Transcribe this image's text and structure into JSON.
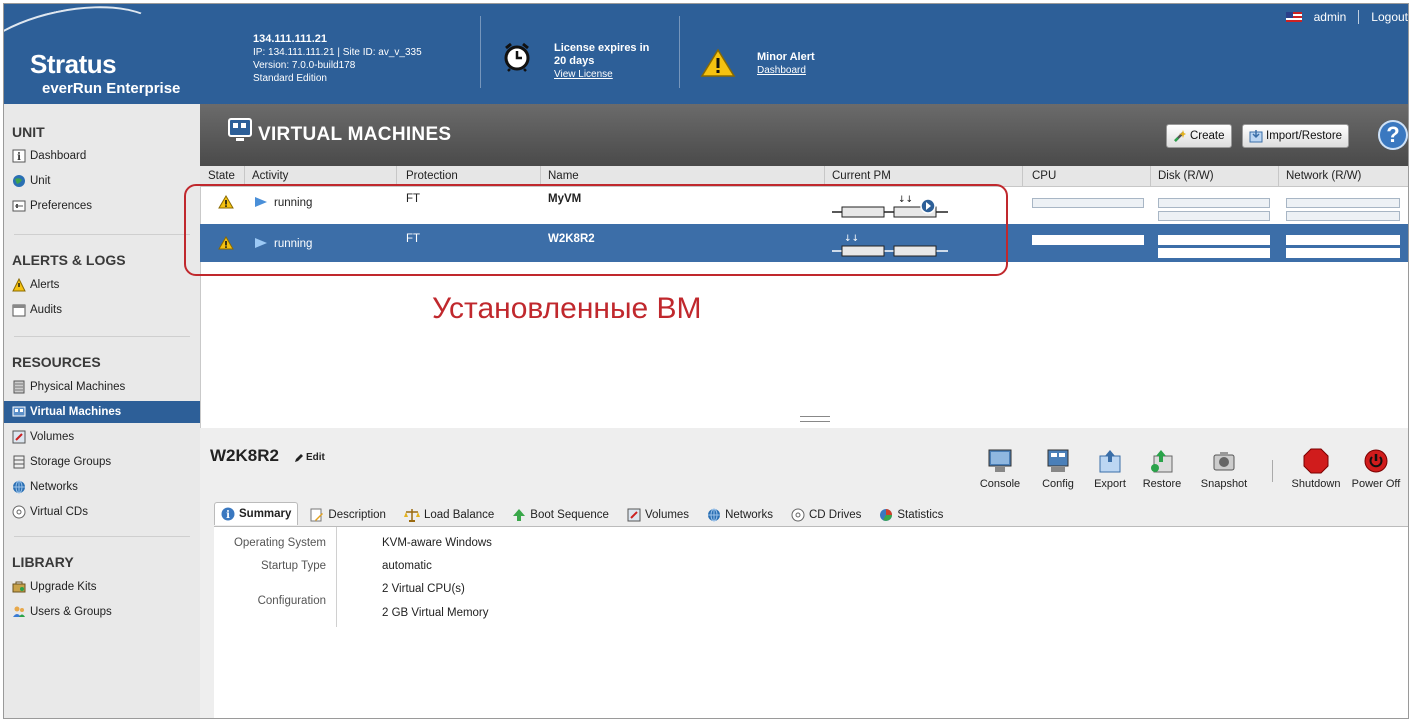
{
  "header": {
    "brand": "Stratus",
    "product": "everRun Enterprise",
    "system": {
      "ip_title": "134.111.111.21",
      "ip_site": "IP: 134.111.111.21  |  Site ID: av_v_335",
      "version": "Version: 7.0.0-build178",
      "edition": "Standard Edition"
    },
    "license": {
      "line1": "License expires in",
      "line2": "20 days",
      "link": "View License"
    },
    "alert": {
      "title": "Minor Alert",
      "link": "Dashboard"
    },
    "user": "admin",
    "logout": "Logout"
  },
  "sidebar": {
    "unit": {
      "heading": "UNIT",
      "items": [
        {
          "label": "Dashboard",
          "icon": "info-icon"
        },
        {
          "label": "Unit",
          "icon": "globe-icon"
        },
        {
          "label": "Preferences",
          "icon": "preferences-icon"
        }
      ]
    },
    "alerts": {
      "heading": "ALERTS & LOGS",
      "items": [
        {
          "label": "Alerts",
          "icon": "warning-icon"
        },
        {
          "label": "Audits",
          "icon": "calendar-icon"
        }
      ]
    },
    "resources": {
      "heading": "RESOURCES",
      "items": [
        {
          "label": "Physical Machines",
          "icon": "server-icon"
        },
        {
          "label": "Virtual Machines",
          "icon": "vm-icon",
          "active": true
        },
        {
          "label": "Volumes",
          "icon": "volume-icon"
        },
        {
          "label": "Storage Groups",
          "icon": "storage-icon"
        },
        {
          "label": "Networks",
          "icon": "network-icon"
        },
        {
          "label": "Virtual CDs",
          "icon": "cd-icon"
        }
      ]
    },
    "library": {
      "heading": "LIBRARY",
      "items": [
        {
          "label": "Upgrade Kits",
          "icon": "kit-icon"
        },
        {
          "label": "Users & Groups",
          "icon": "users-icon"
        }
      ]
    }
  },
  "vm_page": {
    "title": "VIRTUAL MACHINES",
    "create": "Create",
    "import_restore": "Import/Restore",
    "help": "?"
  },
  "table": {
    "columns": [
      "State",
      "Activity",
      "Protection",
      "Name",
      "Current PM",
      "CPU",
      "Disk (R/W)",
      "Network (R/W)"
    ],
    "rows": [
      {
        "state": "warning",
        "activity": "running",
        "protection": "FT",
        "name": "MyVM",
        "selected": false
      },
      {
        "state": "warning",
        "activity": "running",
        "protection": "FT",
        "name": "W2K8R2",
        "selected": true
      }
    ]
  },
  "annotation": "Установленные ВМ",
  "detail": {
    "vm_name": "W2K8R2",
    "edit": "Edit",
    "actions": [
      "Console",
      "Config",
      "Export",
      "Restore",
      "Snapshot",
      "Shutdown",
      "Power Off"
    ],
    "tabs": [
      "Summary",
      "Description",
      "Load Balance",
      "Boot Sequence",
      "Volumes",
      "Networks",
      "CD Drives",
      "Statistics"
    ],
    "summary": {
      "os_label": "Operating System",
      "os_value": "KVM-aware Windows",
      "startup_label": "Startup Type",
      "startup_value": "automatic",
      "config_label": "Configuration",
      "config_cpu": "2 Virtual CPU(s)",
      "config_mem": "2 GB Virtual Memory"
    }
  },
  "colors": {
    "header_bg": "#2d5f98",
    "selected_row": "#3c6ea8",
    "callout": "#c0282d"
  }
}
